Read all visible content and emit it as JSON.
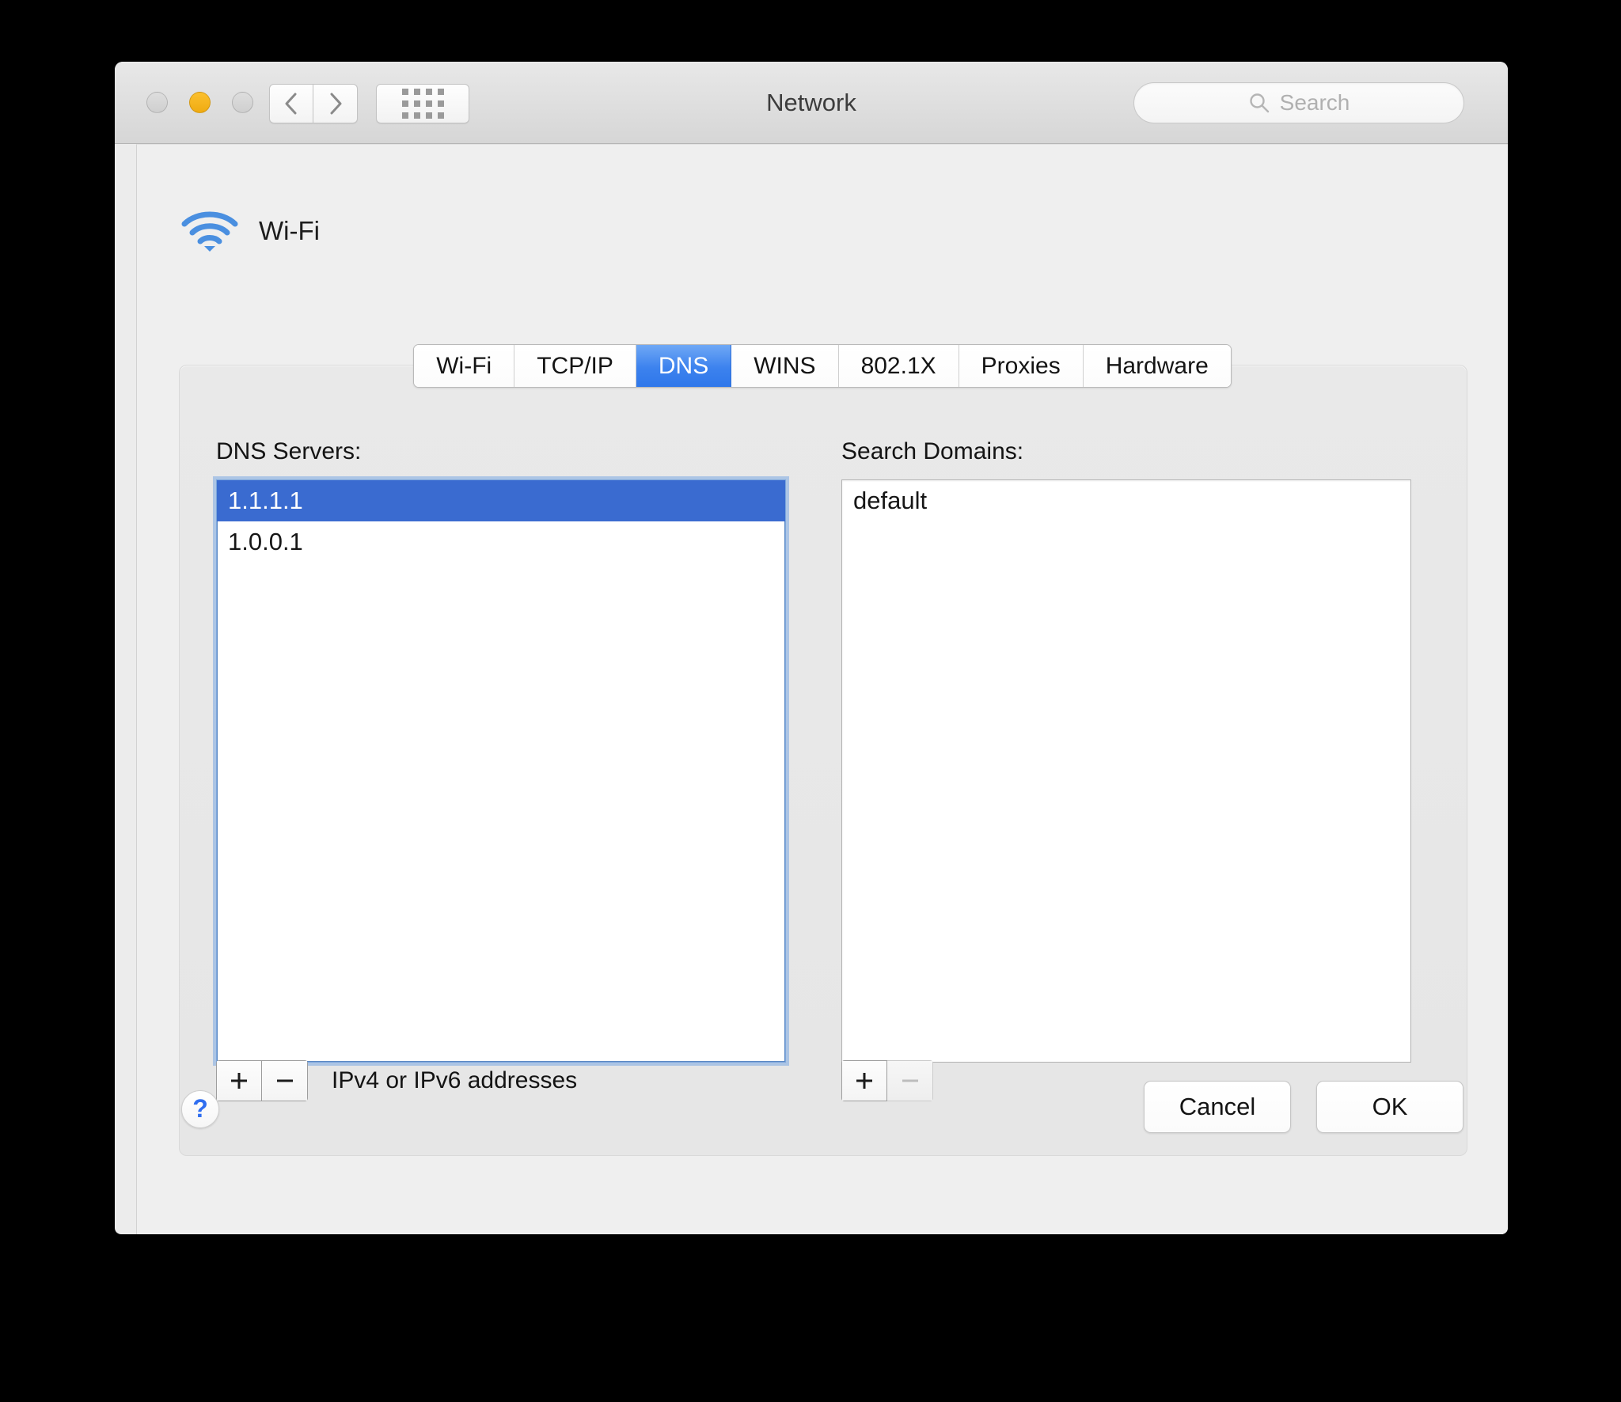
{
  "window": {
    "title": "Network",
    "traffic_lights": [
      {
        "name": "close",
        "color": "#d4d4d4",
        "enabled": false
      },
      {
        "name": "minimize",
        "color": "#f5b719",
        "enabled": true
      },
      {
        "name": "zoom",
        "color": "#d4d4d4",
        "enabled": false
      }
    ],
    "toolbar": {
      "back_icon": "chevron-left-icon",
      "forward_icon": "chevron-right-icon",
      "show_all_icon": "grid-icon"
    },
    "search": {
      "icon": "search-icon",
      "placeholder": "Search",
      "value": ""
    }
  },
  "service": {
    "icon": "wifi-icon",
    "icon_color": "#3d82e0",
    "name": "Wi-Fi"
  },
  "tabs": [
    {
      "label": "Wi-Fi",
      "active": false
    },
    {
      "label": "TCP/IP",
      "active": false
    },
    {
      "label": "DNS",
      "active": true
    },
    {
      "label": "WINS",
      "active": false
    },
    {
      "label": "802.1X",
      "active": false
    },
    {
      "label": "Proxies",
      "active": false
    },
    {
      "label": "Hardware",
      "active": false
    }
  ],
  "accent": {
    "selection_blue": "#3a6bd0",
    "tab_blue": "#3c82ee",
    "focus_ring": "#7aa8e2",
    "help_blue": "#2f6ef0"
  },
  "dns_panel": {
    "label": "DNS Servers:",
    "focused": true,
    "entries": [
      {
        "value": "1.1.1.1",
        "selected": true
      },
      {
        "value": "1.0.0.1",
        "selected": false
      }
    ],
    "add_label": "+",
    "remove_label": "−",
    "add_enabled": true,
    "remove_enabled": true,
    "caption": "IPv4 or IPv6 addresses"
  },
  "search_domains_panel": {
    "label": "Search Domains:",
    "focused": false,
    "entries": [
      {
        "value": "default",
        "selected": false
      }
    ],
    "add_label": "+",
    "remove_label": "−",
    "add_enabled": true,
    "remove_enabled": false,
    "caption": ""
  },
  "footer": {
    "help_label": "?",
    "cancel_label": "Cancel",
    "ok_label": "OK"
  }
}
